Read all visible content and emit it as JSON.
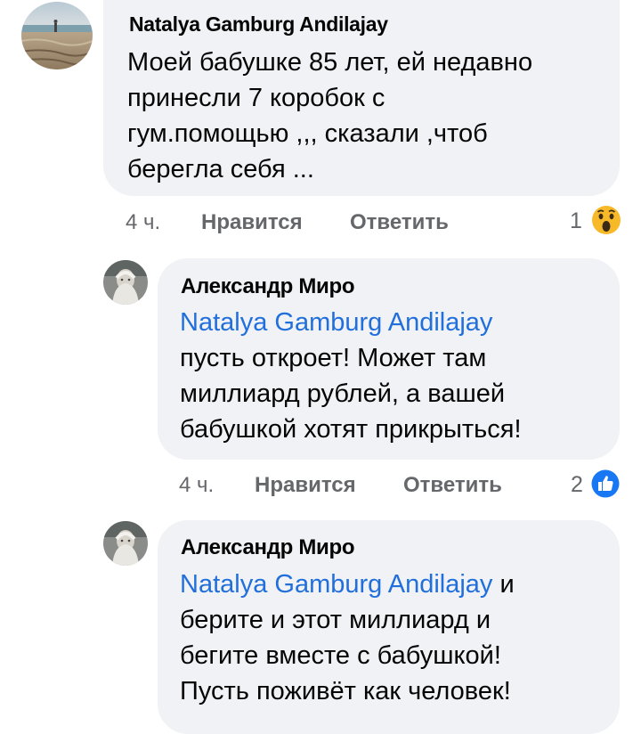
{
  "comments": [
    {
      "author": "Natalya Gamburg Andilajay",
      "lines": [
        "Моей бабушке 85 лет, ей недавно",
        "принесли 7 коробок с",
        "гум.помощью ,,, сказали ,чтоб",
        "берегла себя ..."
      ],
      "time": "4 ч.",
      "like_label": "Нравится",
      "reply_label": "Ответить",
      "reaction_count": "1",
      "reaction_icon": "wow-reaction-icon"
    },
    {
      "author": "Александр Миро",
      "mention": "Natalya Gamburg Andilajay",
      "lines": [
        "пусть откроет! Может там",
        "миллиард рублей, а вашей",
        "бабушкой хотят прикрыться!"
      ],
      "time": "4 ч.",
      "like_label": "Нравится",
      "reply_label": "Ответить",
      "reaction_count": "2",
      "reaction_icon": "like-reaction-icon"
    },
    {
      "author": "Александр Миро",
      "mention": "Natalya Gamburg Andilajay",
      "mention_suffix": " и",
      "lines": [
        "берите и этот миллиард и",
        "бегите вместе с бабушкой!",
        "Пусть поживёт как человек!"
      ]
    }
  ],
  "colors": {
    "bubble": "#f0f2f5",
    "mention": "#216fdb",
    "secondary_text": "#65676b",
    "like_blue": "#1877f2",
    "wow_yellow": "#f7b928"
  }
}
